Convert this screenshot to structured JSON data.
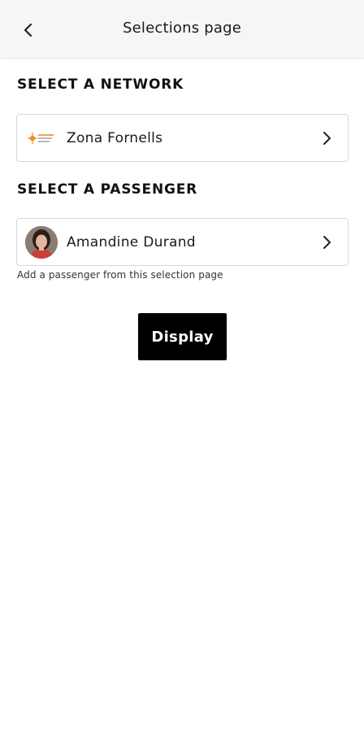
{
  "header": {
    "title": "Selections page",
    "back_icon": "chevron-left-icon"
  },
  "network": {
    "section_title": "SELECT A NETWORK",
    "selected_name": "Zona Fornells",
    "logo_icon": "network-logo-icon"
  },
  "passenger": {
    "section_title": "SELECT A PASSENGER",
    "selected_name": "Amandine Durand",
    "helper_text": "Add a passenger from this selection page",
    "avatar_icon": "passenger-avatar"
  },
  "actions": {
    "display_label": "Display"
  },
  "colors": {
    "primary_button": "#000000",
    "app_bar": "#f6f6f6",
    "card_border": "#d6d6d6"
  }
}
